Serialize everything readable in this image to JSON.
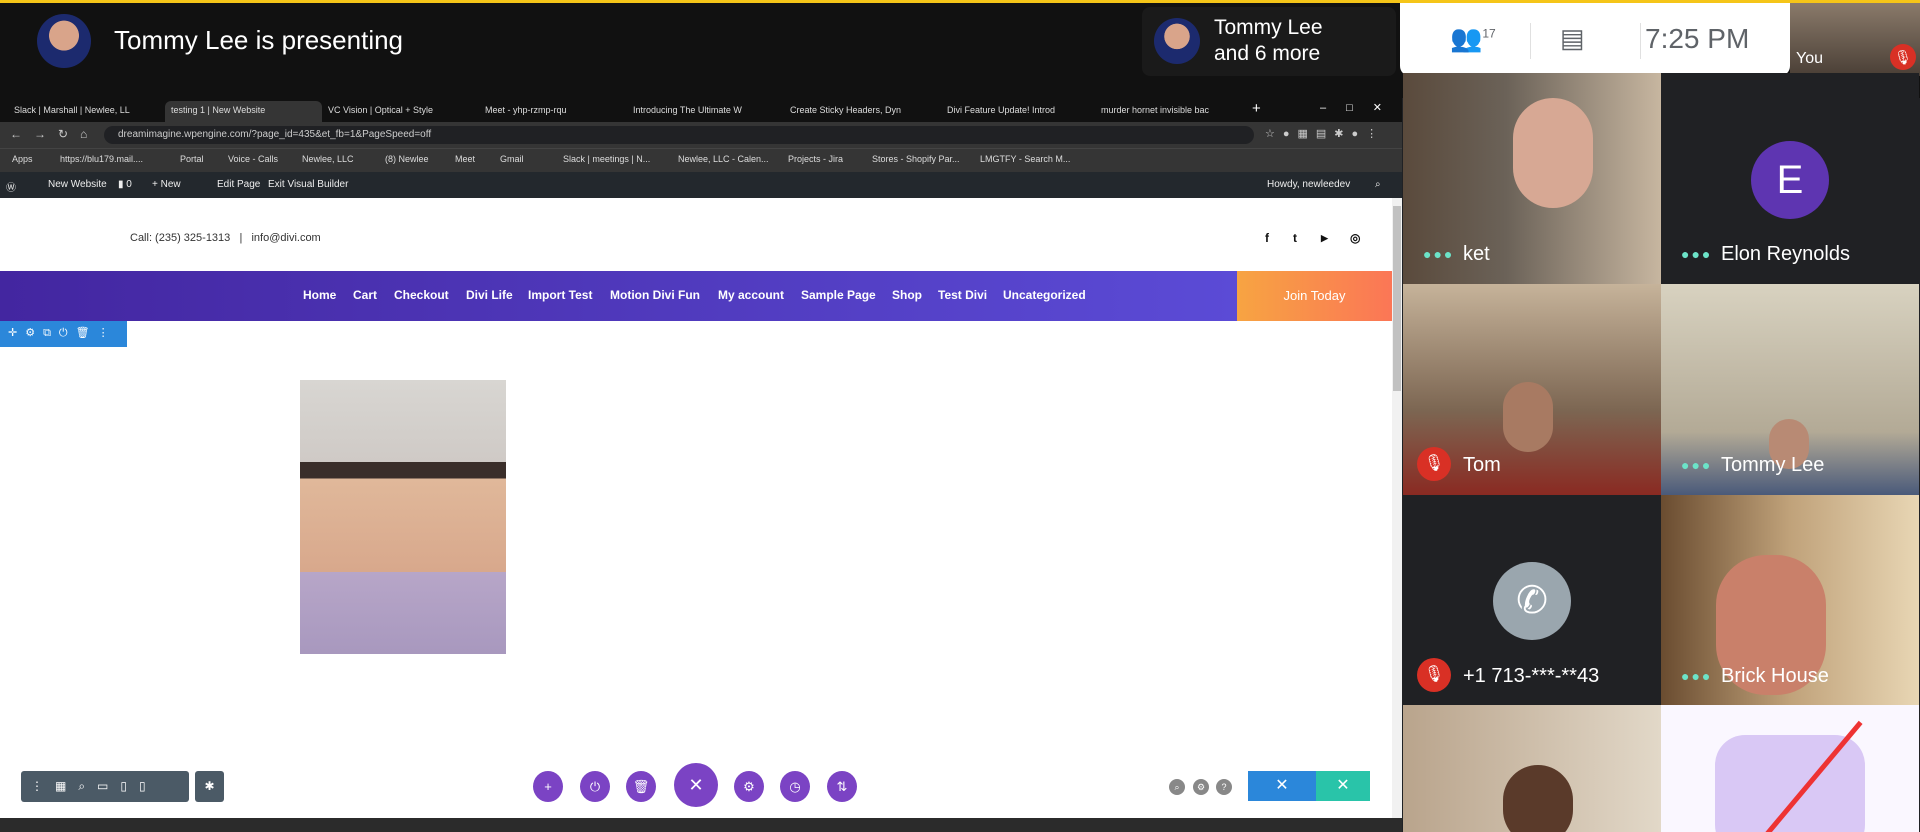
{
  "meet": {
    "presenter_text": "Tommy Lee is presenting",
    "pill_line1": "Tommy Lee",
    "pill_line2": "and 6 more",
    "participant_count": "17",
    "time": "7:25 PM",
    "you_label": "You",
    "tiles": [
      {
        "name": "ket",
        "muted": false
      },
      {
        "name": "Elon Reynolds",
        "initial": "E",
        "muted": false
      },
      {
        "name": "Tom",
        "muted": true
      },
      {
        "name": "Tommy Lee",
        "muted": false
      },
      {
        "name": "+1 713-***-**43",
        "muted": true
      },
      {
        "name": "Brick House",
        "muted": false
      }
    ],
    "colors": {
      "accent": "#f5c518",
      "avatar_purple": "#5e35b1",
      "mute_red": "#d93025"
    }
  },
  "browser": {
    "tabs": [
      "Slack | Marshall | Newlee, LL",
      "testing 1 | New Website",
      "VC Vision | Optical + Style",
      "Meet - yhp-rzmp-rqu",
      "Introducing The Ultimate W",
      "Create Sticky Headers, Dyn",
      "Divi Feature Update! Introd",
      "murder hornet invisible bac"
    ],
    "url": "dreamimagine.wpengine.com/?page_id=435&et_fb=1&PageSpeed=off",
    "bookmarks": [
      "Apps",
      "https://blu179.mail....",
      "Portal",
      "Voice - Calls",
      "Newlee, LLC",
      "(8) Newlee",
      "Meet",
      "Gmail",
      "Slack | meetings | N...",
      "Newlee, LLC - Calen...",
      "Projects - Jira",
      "Stores - Shopify Par...",
      "LMGTFY - Search M..."
    ]
  },
  "wp": {
    "site": "New Website",
    "comments": "0",
    "new": "New",
    "edit": "Edit Page",
    "exit": "Exit Visual Builder",
    "howdy": "Howdy, newleedev"
  },
  "site": {
    "call": "Call: (235) 325-1313   |   info@divi.com",
    "social": [
      "f",
      "t",
      "▶",
      "◎"
    ],
    "nav": [
      "Home",
      "Cart",
      "Checkout",
      "Divi Life",
      "Import Test",
      "Motion Divi Fun",
      "My account",
      "Sample Page",
      "Shop",
      "Test Divi",
      "Uncategorized"
    ],
    "cta": "Join Today"
  }
}
